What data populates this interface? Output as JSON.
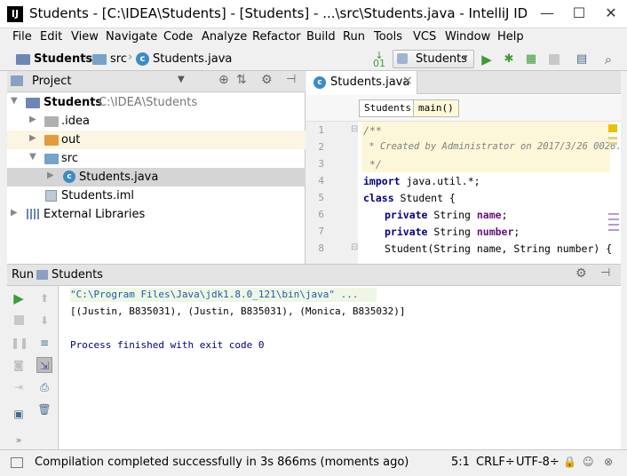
{
  "window": {
    "app_icon": "IJ",
    "title": "Students - [C:\\IDEA\\Students] - [Students] - ...\\src\\Students.java - IntelliJ IDE...",
    "minimize": "—",
    "maximize": "☐",
    "close": "✕"
  },
  "menu": [
    "File",
    "Edit",
    "View",
    "Navigate",
    "Code",
    "Analyze",
    "Refactor",
    "Build",
    "Run",
    "Tools",
    "VCS",
    "Window",
    "Help"
  ],
  "breadcrumb": {
    "project": "Students",
    "folder": "src",
    "file": "Students.java"
  },
  "toolbar": {
    "run_config": "Students",
    "dropdown": "▾"
  },
  "project_panel": {
    "title": "Project",
    "tree": [
      {
        "label": "Students",
        "path": "C:\\IDEA\\Students"
      },
      {
        "label": ".idea"
      },
      {
        "label": "out"
      },
      {
        "label": "src"
      },
      {
        "label": "Students.java"
      },
      {
        "label": "Students.iml"
      },
      {
        "label": "External Libraries"
      }
    ]
  },
  "editor": {
    "tab_label": "Students.java",
    "tab_close": "×",
    "code_crumbs": [
      "Students",
      "main()"
    ],
    "line_numbers": [
      "1",
      "2",
      "3",
      "4",
      "5",
      "6",
      "7",
      "8"
    ],
    "lines": {
      "l1": "/**",
      "l2": " * Created by Administrator on 2017/3/26 0026.",
      "l3": " */",
      "l4_kw": "import",
      "l4_rest": " java.util.*;",
      "l5_kw": "class",
      "l5_rest": " Student {",
      "l6_kw": "private",
      "l6_type": " String ",
      "l6_field": "name",
      "l6_end": ";",
      "l7_kw": "private",
      "l7_type": " String ",
      "l7_field": "number",
      "l7_end": ";",
      "l8": "Student(String name, String number) {"
    }
  },
  "run_panel": {
    "label": "Run",
    "config": "Students",
    "console": [
      "\"C:\\Program Files\\Java\\jdk1.8.0_121\\bin\\java\" ...",
      "[(Justin, B835031), (Justin, B835031), (Monica, B835032)]",
      "",
      "Process finished with exit code 0"
    ]
  },
  "status": {
    "message": "Compilation completed successfully in 3s 866ms (moments ago)",
    "position": "5:1",
    "line_sep": "CRLF÷",
    "encoding": "UTF-8÷"
  },
  "colors": {
    "selection": "#d5d5d5",
    "highlight_row": "#fbf5e2",
    "accent_green": "#3d9b35",
    "console_cmd": "#1e5aa8",
    "console_text": "#000080"
  }
}
